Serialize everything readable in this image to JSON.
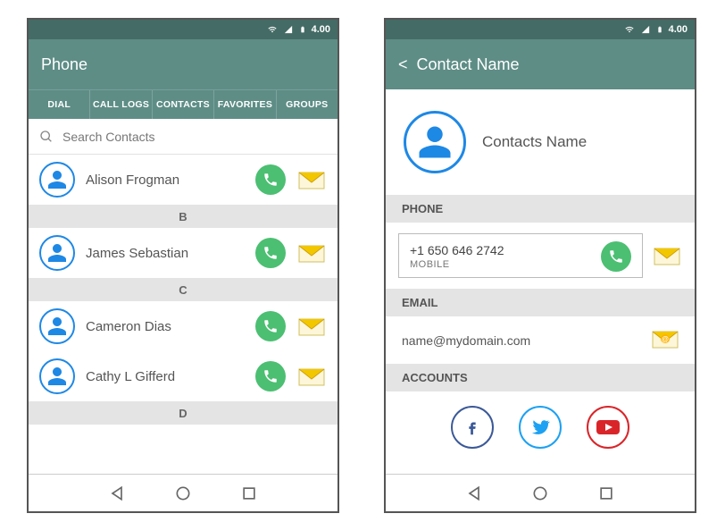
{
  "statusbar": {
    "time": "4.00"
  },
  "screen1": {
    "title": "Phone",
    "tabs": [
      {
        "label": "DIAL"
      },
      {
        "label": "CALL LOGS"
      },
      {
        "label": "CONTACTS"
      },
      {
        "label": "FAVORITES"
      },
      {
        "label": "GROUPS"
      }
    ],
    "search_placeholder": "Search Contacts",
    "rows": [
      {
        "name": "Alison Frogman"
      }
    ],
    "sections": [
      {
        "letter": "B",
        "rows": [
          {
            "name": "James Sebastian"
          }
        ]
      },
      {
        "letter": "C",
        "rows": [
          {
            "name": "Cameron Dias"
          },
          {
            "name": "Cathy L Gifferd"
          }
        ]
      },
      {
        "letter": "D",
        "rows": []
      }
    ]
  },
  "screen2": {
    "back_label": "<",
    "title": "Contact Name",
    "name": "Contacts Name",
    "section_phone": "PHONE",
    "phone": {
      "number": "+1  650 646 2742",
      "type": "MOBILE"
    },
    "section_email": "EMAIL",
    "email": "name@mydomain.com",
    "section_accounts": "ACCOUNTS",
    "accounts": {
      "fb": "f",
      "tw": "twitter",
      "yt": "YouTube"
    }
  }
}
